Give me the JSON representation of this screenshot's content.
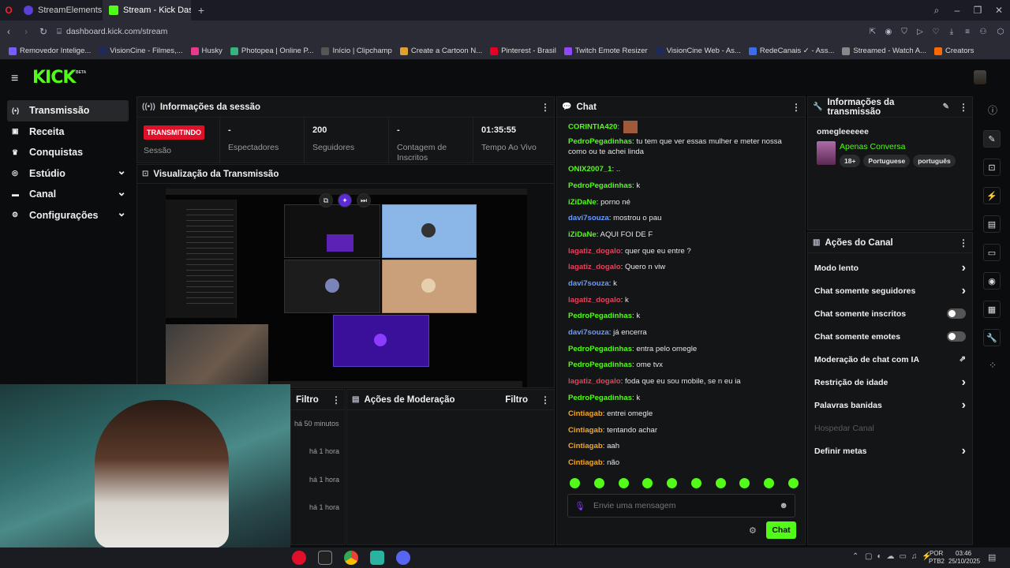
{
  "browser": {
    "tabs": [
      {
        "title": "StreamElements - Songre",
        "active": false
      },
      {
        "title": "Stream - Kick Dashboard",
        "active": true
      }
    ],
    "url": "dashboard.kick.com/stream",
    "bookmarks": [
      "Removedor Intelige...",
      "VisionCine - Filmes,...",
      "Husky",
      "Photopea | Online P...",
      "Início | Clipchamp",
      "Create a Cartoon N...",
      "Pinterest - Brasil",
      "Twitch Emote Resizer",
      "VisionCine Web - As...",
      "RedeCanais ✓ - Ass...",
      "Streamed - Watch A...",
      "Creators"
    ]
  },
  "header": {
    "logo": "KICK",
    "beta": "BETA"
  },
  "sidebar": {
    "items": [
      {
        "label": "Transmissão",
        "icon": "broadcast-icon",
        "active": true,
        "chevron": false
      },
      {
        "label": "Receita",
        "icon": "wallet-icon",
        "active": false,
        "chevron": false
      },
      {
        "label": "Conquistas",
        "icon": "trophy-icon",
        "active": false,
        "chevron": false
      },
      {
        "label": "Estúdio",
        "icon": "studio-icon",
        "active": false,
        "chevron": true
      },
      {
        "label": "Canal",
        "icon": "channel-icon",
        "active": false,
        "chevron": true
      },
      {
        "label": "Configurações",
        "icon": "gear-icon",
        "active": false,
        "chevron": true
      }
    ]
  },
  "session": {
    "title": "Informações da sessão",
    "status": "TRANSMITINDO",
    "status_label": "Sessão",
    "stats": [
      {
        "value": "-",
        "label": "Espectadores"
      },
      {
        "value": "200",
        "label": "Seguidores"
      },
      {
        "value": "-",
        "label": "Contagem de Inscritos"
      },
      {
        "value": "01:35:55",
        "label": "Tempo Ao Vivo"
      }
    ]
  },
  "preview": {
    "title": "Visualização da Transmissão"
  },
  "activity": {
    "filter_label": "Filtro",
    "times": [
      "há 50 minutos",
      "há 1 hora",
      "há 1 hora",
      "há 1 hora"
    ]
  },
  "moderation": {
    "title": "Ações de Moderação",
    "filter_label": "Filtro"
  },
  "chat": {
    "title": "Chat",
    "messages": [
      {
        "user": "CORINTIA420",
        "text": "",
        "color": "#53fc18"
      },
      {
        "user": "PedroPegadinhas",
        "text": "tu tem que ver essas mulher e meter nossa como ou te achei linda",
        "color": "#53fc18"
      },
      {
        "user": "ONIX2007_1",
        "text": "..",
        "color": "#53fc18"
      },
      {
        "user": "PedroPegadinhas",
        "text": "k",
        "color": "#53fc18"
      },
      {
        "user": "iZiDaNe",
        "text": "porno né",
        "color": "#53fc18"
      },
      {
        "user": "davi7souza",
        "text": "mostrou o pau",
        "color": "#6b9bff"
      },
      {
        "user": "iZiDaNe",
        "text": "AQUI FOI DE F",
        "color": "#53fc18"
      },
      {
        "user": "lagatiz_dogalo",
        "text": "quer que eu entre ?",
        "color": "#e8415a"
      },
      {
        "user": "lagatiz_dogalo",
        "text": "Quero n viw",
        "color": "#e8415a"
      },
      {
        "user": "davi7souza",
        "text": "k",
        "color": "#6b9bff"
      },
      {
        "user": "lagatiz_dogalo",
        "text": "k",
        "color": "#e8415a"
      },
      {
        "user": "PedroPegadinhas",
        "text": "k",
        "color": "#53fc18"
      },
      {
        "user": "davi7souza",
        "text": "já encerra",
        "color": "#6b9bff"
      },
      {
        "user": "PedroPegadinhas",
        "text": "entra pelo omegle",
        "color": "#53fc18"
      },
      {
        "user": "PedroPegadinhas",
        "text": "ome tvx",
        "color": "#53fc18"
      },
      {
        "user": "lagatiz_dogalo",
        "text": "foda que eu sou mobile, se n eu ia",
        "color": "#e8415a"
      },
      {
        "user": "PedroPegadinhas",
        "text": "k",
        "color": "#53fc18"
      },
      {
        "user": "Cintiagab",
        "text": "entrei omegle",
        "color": "#f5a623"
      },
      {
        "user": "Cintiagab",
        "text": "tentando achar",
        "color": "#f5a623"
      },
      {
        "user": "Cintiagab",
        "text": "aah",
        "color": "#f5a623"
      },
      {
        "user": "Cintiagab",
        "text": "não",
        "color": "#f5a623"
      }
    ],
    "placeholder": "Envie uma mensagem",
    "send_label": "Chat"
  },
  "stream_info": {
    "title": "Informações da transmissão",
    "stream_title": "omegleeeeee",
    "category": "Apenas Conversa",
    "tags": [
      "18+",
      "Portuguese",
      "português"
    ]
  },
  "channel_actions": {
    "title": "Ações do Canal",
    "rows": [
      {
        "label": "Modo lento",
        "control": "chevron"
      },
      {
        "label": "Chat somente seguidores",
        "control": "chevron"
      },
      {
        "label": "Chat somente inscritos",
        "control": "toggle"
      },
      {
        "label": "Chat somente emotes",
        "control": "toggle"
      },
      {
        "label": "Moderação de chat com IA",
        "control": "external"
      },
      {
        "label": "Restrição de idade",
        "control": "chevron"
      },
      {
        "label": "Palavras banidas",
        "control": "chevron"
      },
      {
        "label": "Hospedar Canal",
        "control": "disabled"
      },
      {
        "label": "Definir metas",
        "control": "chevron"
      }
    ]
  },
  "taskbar": {
    "lang": "POR",
    "lang2": "PTB2",
    "time": "03:46",
    "date": "25/10/2025"
  },
  "colors": {
    "accent": "#53fc18",
    "live": "#e0102a",
    "panel": "#141517"
  }
}
